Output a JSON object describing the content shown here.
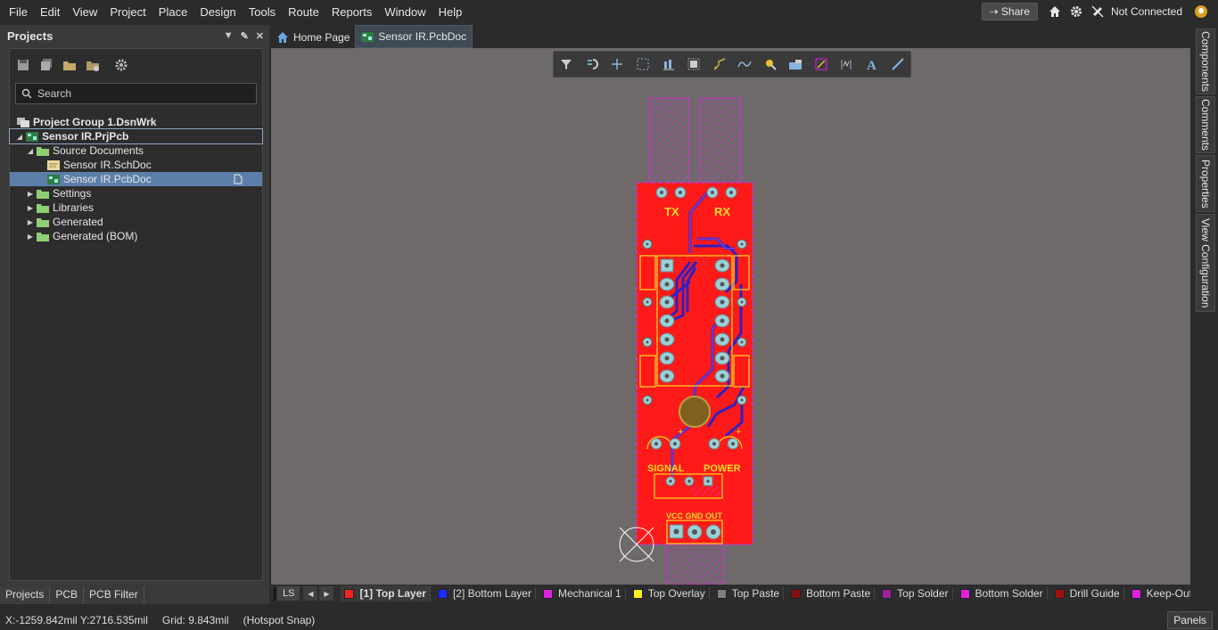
{
  "menu": {
    "items": [
      "File",
      "Edit",
      "View",
      "Project",
      "Place",
      "Design",
      "Tools",
      "Route",
      "Reports",
      "Window",
      "Help"
    ],
    "share_label": "Share",
    "connection_status": "Not Connected"
  },
  "projects_panel": {
    "title": "Projects",
    "search_placeholder": "Search",
    "tree": [
      {
        "label": "Project Group 1.DsnWrk"
      },
      {
        "label": "Sensor IR.PrjPcb"
      },
      {
        "label": "Source Documents"
      },
      {
        "label": "Sensor IR.SchDoc"
      },
      {
        "label": "Sensor IR.PcbDoc"
      },
      {
        "label": "Settings"
      },
      {
        "label": "Libraries"
      },
      {
        "label": "Generated"
      },
      {
        "label": "Generated (BOM)"
      }
    ],
    "bottom_tabs": [
      "Projects",
      "PCB",
      "PCB Filter"
    ]
  },
  "doc_tabs": [
    "Home Page",
    "Sensor IR.PcbDoc"
  ],
  "pcb": {
    "labels": {
      "tx": "TX",
      "rx": "RX",
      "signal": "SIGNAL",
      "power": "POWER",
      "pins": "VCC GND OUT",
      "plus": "+"
    }
  },
  "side_tabs": [
    "Components",
    "Comments",
    "Properties",
    "View Configuration"
  ],
  "layer_bar": {
    "ls_label": "LS",
    "layers": [
      {
        "name": "[1] Top Layer",
        "color": "#ff2020"
      },
      {
        "name": "[2] Bottom Layer",
        "color": "#1a2cff"
      },
      {
        "name": "Mechanical 1",
        "color": "#e020e0"
      },
      {
        "name": "Top Overlay",
        "color": "#ffee22"
      },
      {
        "name": "Top Paste",
        "color": "#808080"
      },
      {
        "name": "Bottom Paste",
        "color": "#801010"
      },
      {
        "name": "Top Solder",
        "color": "#a020a0"
      },
      {
        "name": "Bottom Solder",
        "color": "#e020e0"
      },
      {
        "name": "Drill Guide",
        "color": "#a01010"
      },
      {
        "name": "Keep-Out Lay",
        "color": "#e020e0"
      }
    ]
  },
  "status": {
    "coords": "X:-1259.842mil Y:2716.535mil",
    "grid": "Grid: 9.843mil",
    "snap": "(Hotspot Snap)",
    "panels_label": "Panels"
  }
}
